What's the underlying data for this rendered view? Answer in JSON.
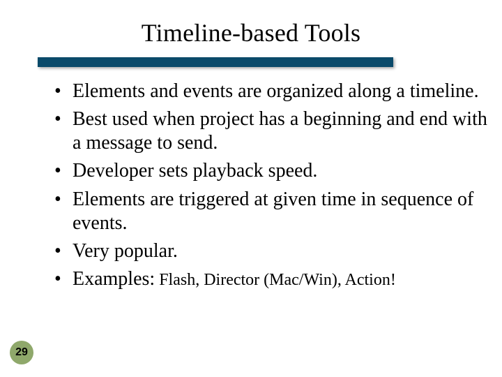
{
  "slide": {
    "title": "Timeline-based Tools",
    "bullets": [
      "Elements and events are organized along a timeline.",
      "Best used when project has a beginning and end with a message to send.",
      "Developer sets playback speed.",
      "Elements are triggered at given time in sequence of events.",
      "Very popular."
    ],
    "examples_label": "Examples:",
    "examples_tail": " Flash, Director (Mac/Win), Action!",
    "page_number": "29"
  },
  "colors": {
    "bar": "#0a4a6a",
    "badge": "#8fa86b"
  }
}
